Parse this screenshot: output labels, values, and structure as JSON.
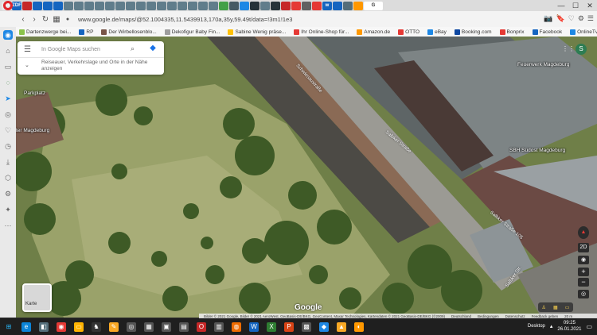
{
  "browser": {
    "tabs": [
      {
        "color": "#e8e8e8",
        "text": "Gi",
        "active": false
      },
      {
        "color": "#1565c0",
        "text": "ZDF",
        "active": false
      },
      {
        "color": "#c62828",
        "text": "",
        "active": false
      },
      {
        "color": "#1565c0",
        "text": "",
        "active": false
      },
      {
        "color": "#1565c0",
        "text": "",
        "active": false
      },
      {
        "color": "#1565c0",
        "text": "",
        "active": false
      },
      {
        "color": "#607d8b",
        "text": "",
        "active": false
      },
      {
        "color": "#607d8b",
        "text": "",
        "active": false
      },
      {
        "color": "#607d8b",
        "text": "",
        "active": false
      },
      {
        "color": "#607d8b",
        "text": "",
        "active": false
      },
      {
        "color": "#607d8b",
        "text": "",
        "active": false
      },
      {
        "color": "#607d8b",
        "text": "",
        "active": false
      },
      {
        "color": "#607d8b",
        "text": "",
        "active": false
      },
      {
        "color": "#607d8b",
        "text": "",
        "active": false
      },
      {
        "color": "#607d8b",
        "text": "",
        "active": false
      },
      {
        "color": "#607d8b",
        "text": "",
        "active": false
      },
      {
        "color": "#607d8b",
        "text": "",
        "active": false
      },
      {
        "color": "#607d8b",
        "text": "",
        "active": false
      },
      {
        "color": "#607d8b",
        "text": "",
        "active": false
      },
      {
        "color": "#607d8b",
        "text": "",
        "active": false
      },
      {
        "color": "#607d8b",
        "text": "",
        "active": false
      },
      {
        "color": "#43a047",
        "text": "",
        "active": false
      },
      {
        "color": "#455a64",
        "text": "",
        "active": false
      },
      {
        "color": "#1e88e5",
        "text": "",
        "active": false
      },
      {
        "color": "#263238",
        "text": "",
        "active": false
      },
      {
        "color": "#607d8b",
        "text": "",
        "active": false
      },
      {
        "color": "#263238",
        "text": "",
        "active": false
      },
      {
        "color": "#c62828",
        "text": "",
        "active": false
      },
      {
        "color": "#e53935",
        "text": "",
        "active": false
      },
      {
        "color": "#616161",
        "text": "",
        "active": false
      },
      {
        "color": "#e53935",
        "text": "",
        "active": false
      },
      {
        "color": "#1565c0",
        "text": "w",
        "active": false
      },
      {
        "color": "#1565c0",
        "text": "",
        "active": false
      },
      {
        "color": "#546e7a",
        "text": "",
        "active": false
      },
      {
        "color": "#ff9800",
        "text": "",
        "active": false
      },
      {
        "color": "#ffffff",
        "text": "G",
        "active": true
      }
    ],
    "window_controls": [
      "—",
      "☐",
      "✕"
    ],
    "url": "www.google.de/maps/@52.1004335,11.5439913,170a,35y,59.49t/data=!3m1!1e3",
    "address_icons": [
      "📷",
      "🔖",
      "♡",
      "⚙",
      "☰"
    ]
  },
  "bookmarks": [
    {
      "label": "Dartenzwerge bei...",
      "color": "#8bc34a"
    },
    {
      "label": "RP",
      "color": "#1565c0"
    },
    {
      "label": "Der Wirbellosenblo...",
      "color": "#795548"
    },
    {
      "label": "Dekofigur Baby Fin...",
      "color": "#9e9e9e"
    },
    {
      "label": "Sabine Wenig präse...",
      "color": "#ffc107"
    },
    {
      "label": "Ihr Online-Shop für...",
      "color": "#e53935"
    },
    {
      "label": "Amazon.de",
      "color": "#ff9800"
    },
    {
      "label": "OTTO",
      "color": "#e53935"
    },
    {
      "label": "eBay",
      "color": "#1e88e5"
    },
    {
      "label": "Booking.com",
      "color": "#0d47a1"
    },
    {
      "label": "Bonprix",
      "color": "#e53935"
    },
    {
      "label": "Facebook",
      "color": "#1565c0"
    },
    {
      "label": "OnlineTvRecorder.c...",
      "color": "#1e88e5"
    }
  ],
  "sidebar_icons": [
    "messenger-icon",
    "home-icon",
    "briefcase-icon",
    "whatsapp-icon",
    "telegram-icon",
    "instagram-icon",
    "heart-icon",
    "history-icon",
    "download-icon",
    "box-icon",
    "settings-icon",
    "bulb-icon",
    "more-icon"
  ],
  "search": {
    "placeholder": "In Google Maps suchen",
    "nearby_text": "Reiseauer, Verkehrslage und Orte in der Nähe anzeigen"
  },
  "map_labels": {
    "parkplatz": "Parkplatz",
    "left_label": "ter Magdeburg",
    "corner_label": "Feuerwerk Magdeburg",
    "sbh": "SBH Südost Magdeburg",
    "street_top": "Schwiesaustraße",
    "street_mid": "Salbker Straße",
    "street_long": "Salbker Straße 105",
    "street_bottom": "Salbker Str."
  },
  "layers_label": "Karte",
  "google_logo": "Google",
  "avatar_letter": "S",
  "controls": {
    "zoom_in": "+",
    "zoom_out": "−",
    "compass": "▲",
    "tilt": "2D"
  },
  "footer": [
    "Bilder © 2021 Google, Bilder © 2021 AeroWest, GeoBasis-DE/BKG, GeoContent, Maxar Technologies, Kartendaten © 2021 GeoBasis-DE/BKG (©2009)",
    "Deutschland",
    "Bedingungen",
    "Datenschutz",
    "Feedback geben",
    "20 m"
  ],
  "taskbar": {
    "icons": [
      {
        "name": "windows-start-icon",
        "color": "#29b6f6",
        "glyph": "⊞"
      },
      {
        "name": "edge-icon",
        "color": "#0b84d8",
        "glyph": "e"
      },
      {
        "name": "store-icon",
        "color": "#546e7a",
        "glyph": "◧"
      },
      {
        "name": "chrome-icon",
        "color": "#e53935",
        "glyph": "◉"
      },
      {
        "name": "file-explorer-icon",
        "color": "#ffb300",
        "glyph": "▭"
      },
      {
        "name": "game-icon",
        "color": "#333",
        "glyph": "♞"
      },
      {
        "name": "paint-icon",
        "color": "#f9a825",
        "glyph": "✎"
      },
      {
        "name": "camera-icon",
        "color": "#555",
        "glyph": "◎"
      },
      {
        "name": "media-icon",
        "color": "#555",
        "glyph": "▦"
      },
      {
        "name": "photo-icon",
        "color": "#555",
        "glyph": "▣"
      },
      {
        "name": "calculator-icon",
        "color": "#555",
        "glyph": "▤"
      },
      {
        "name": "opera-taskbar-icon",
        "color": "#c62828",
        "glyph": "O"
      },
      {
        "name": "app-icon",
        "color": "#555",
        "glyph": "▥"
      },
      {
        "name": "firefox-icon",
        "color": "#ef6c00",
        "glyph": "◍"
      },
      {
        "name": "word-icon",
        "color": "#1565c0",
        "glyph": "W"
      },
      {
        "name": "excel-icon",
        "color": "#2e7d32",
        "glyph": "X"
      },
      {
        "name": "powerpoint-icon",
        "color": "#d84315",
        "glyph": "P"
      },
      {
        "name": "app2-icon",
        "color": "#555",
        "glyph": "▩"
      },
      {
        "name": "store2-icon",
        "color": "#1e88e5",
        "glyph": "◆"
      },
      {
        "name": "picture-icon",
        "color": "#f9a825",
        "glyph": "▲"
      },
      {
        "name": "bing-icon",
        "color": "#ff9800",
        "glyph": "◐"
      }
    ],
    "desktop_label": "Desktop",
    "time": "09:25",
    "date": "26.01.2021"
  }
}
